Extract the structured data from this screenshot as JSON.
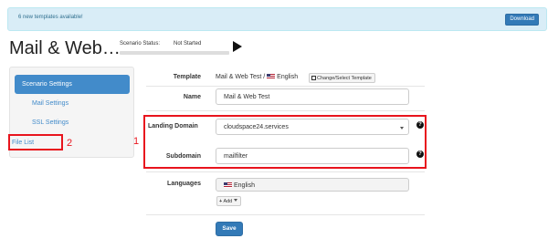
{
  "alert": {
    "message": "6 new templates available!",
    "download_label": "Download"
  },
  "page": {
    "title": "Mail & Web…",
    "status_label": "Scenario Status:",
    "status_value": "Not Started"
  },
  "sidebar": {
    "items": [
      {
        "label": "Scenario Settings"
      },
      {
        "label": "Mail Settings"
      },
      {
        "label": "SSL Settings"
      },
      {
        "label": "File List"
      }
    ]
  },
  "form": {
    "template_label": "Template",
    "template_value": "Mail & Web Test / ",
    "template_lang": "English",
    "change_template_label": "Change/Select Template",
    "name_label": "Name",
    "name_value": "Mail & Web Test",
    "landing_domain_label": "Landing Domain",
    "landing_domain_value": "cloudspace24.services",
    "subdomain_label": "Subdomain",
    "subdomain_value": "mailfilter",
    "languages_label": "Languages",
    "language_value": "English",
    "add_label": "Add",
    "save_label": "Save"
  },
  "annotations": {
    "one": "1",
    "two": "2"
  },
  "colors": {
    "primary": "#337ab7",
    "alert_bg": "#d9edf7",
    "annotation": "#e8141d"
  }
}
